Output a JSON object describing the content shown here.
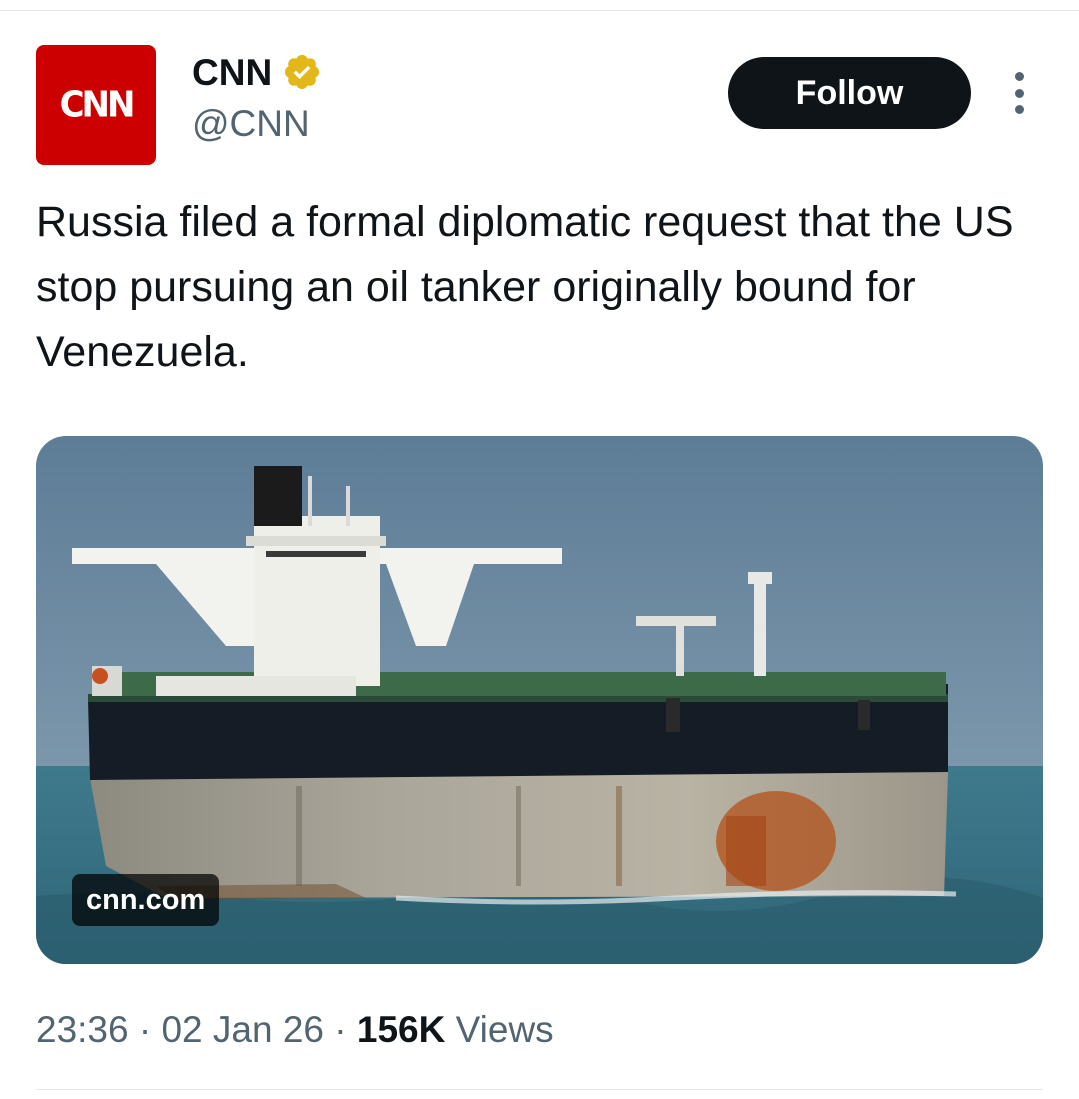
{
  "author": {
    "logo_text": "CNN",
    "display_name": "CNN",
    "handle": "@CNN",
    "verified_icon": "gold-verified-badge-icon",
    "brand_color": "#cc0000",
    "badge_color": "#e2b719"
  },
  "actions": {
    "follow_label": "Follow",
    "more_icon": "vertical-ellipsis-icon"
  },
  "tweet": {
    "text": "Russia filed a formal diplomatic request that the US stop pursuing an oil tanker originally bound for Venezuela."
  },
  "media": {
    "description_icon": "oil-tanker-photo",
    "source_label": "cnn.com"
  },
  "meta": {
    "time": "23:36",
    "separator": "·",
    "date": "02 Jan 26",
    "views_count": "156K",
    "views_label": "Views"
  }
}
